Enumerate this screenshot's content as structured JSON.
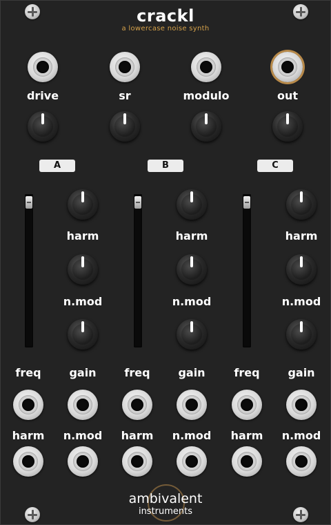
{
  "module": {
    "name": "crackl",
    "tagline": "a lowercase noise synth"
  },
  "top_jacks": [
    {
      "label": "drive",
      "type": "input"
    },
    {
      "label": "sr",
      "type": "input"
    },
    {
      "label": "modulo",
      "type": "input"
    },
    {
      "label": "out",
      "type": "output"
    }
  ],
  "voices": [
    {
      "id": "A",
      "slider_label": "freq",
      "knobs": [
        {
          "label": "harm"
        },
        {
          "label": "n.mod"
        },
        {
          "label": "gain"
        }
      ]
    },
    {
      "id": "B",
      "slider_label": "freq",
      "knobs": [
        {
          "label": "harm"
        },
        {
          "label": "n.mod"
        },
        {
          "label": "gain"
        }
      ]
    },
    {
      "id": "C",
      "slider_label": "freq",
      "knobs": [
        {
          "label": "harm"
        },
        {
          "label": "n.mod"
        },
        {
          "label": "gain"
        }
      ]
    }
  ],
  "cv_row1": [
    {
      "label": "freq"
    },
    {
      "label": "gain"
    },
    {
      "label": "freq"
    },
    {
      "label": "gain"
    },
    {
      "label": "freq"
    },
    {
      "label": "gain"
    }
  ],
  "cv_row2": [
    {
      "label": "harm"
    },
    {
      "label": "n.mod"
    },
    {
      "label": "harm"
    },
    {
      "label": "n.mod"
    },
    {
      "label": "harm"
    },
    {
      "label": "n.mod"
    }
  ],
  "brand": {
    "line1": "ambivalent",
    "line2": "instruments"
  },
  "colors": {
    "panel": "#232323",
    "accent": "#d6a24a",
    "text": "#ffffff"
  }
}
